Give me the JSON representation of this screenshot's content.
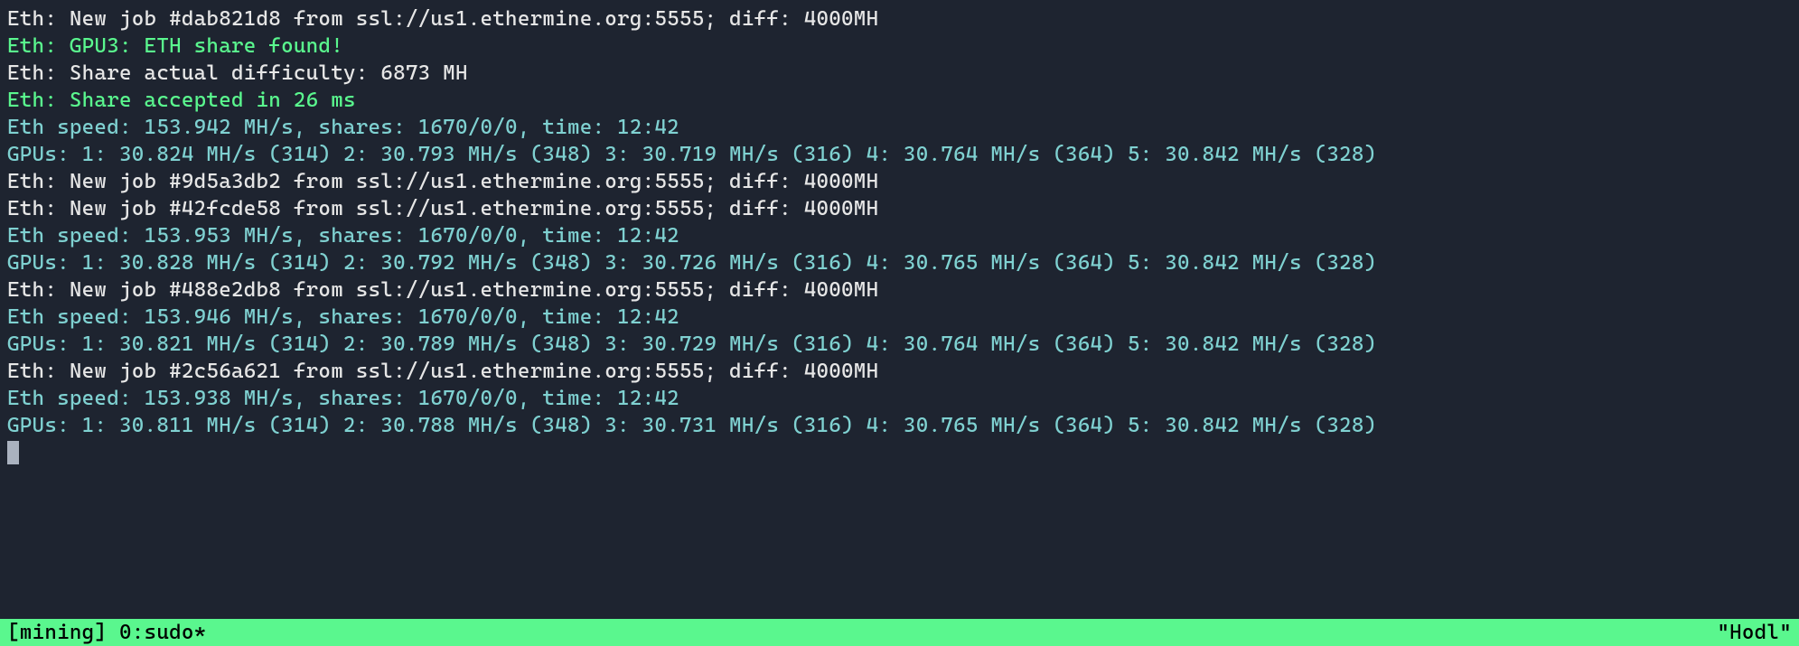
{
  "colors": {
    "bg": "#1e2430",
    "white": "#e6e6e6",
    "green": "#5af78e",
    "cyan": "#7fd1d1",
    "statusbar_bg": "#5af78e",
    "statusbar_fg": "#000000"
  },
  "lines": [
    {
      "color": "white",
      "text": "Eth: New job #dab821d8 from ssl://us1.ethermine.org:5555; diff: 4000MH"
    },
    {
      "color": "green",
      "text": "Eth: GPU3: ETH share found!"
    },
    {
      "color": "white",
      "text": "Eth: Share actual difficulty: 6873 MH"
    },
    {
      "color": "green",
      "text": "Eth: Share accepted in 26 ms"
    },
    {
      "color": "cyan",
      "text": "Eth speed: 153.942 MH/s, shares: 1670/0/0, time: 12:42"
    },
    {
      "color": "cyan",
      "text": "GPUs: 1: 30.824 MH/s (314) 2: 30.793 MH/s (348) 3: 30.719 MH/s (316) 4: 30.764 MH/s (364) 5: 30.842 MH/s (328)"
    },
    {
      "color": "white",
      "text": "Eth: New job #9d5a3db2 from ssl://us1.ethermine.org:5555; diff: 4000MH"
    },
    {
      "color": "white",
      "text": "Eth: New job #42fcde58 from ssl://us1.ethermine.org:5555; diff: 4000MH"
    },
    {
      "color": "cyan",
      "text": "Eth speed: 153.953 MH/s, shares: 1670/0/0, time: 12:42"
    },
    {
      "color": "cyan",
      "text": "GPUs: 1: 30.828 MH/s (314) 2: 30.792 MH/s (348) 3: 30.726 MH/s (316) 4: 30.765 MH/s (364) 5: 30.842 MH/s (328)"
    },
    {
      "color": "white",
      "text": "Eth: New job #488e2db8 from ssl://us1.ethermine.org:5555; diff: 4000MH"
    },
    {
      "color": "cyan",
      "text": "Eth speed: 153.946 MH/s, shares: 1670/0/0, time: 12:42"
    },
    {
      "color": "cyan",
      "text": "GPUs: 1: 30.821 MH/s (314) 2: 30.789 MH/s (348) 3: 30.729 MH/s (316) 4: 30.764 MH/s (364) 5: 30.842 MH/s (328)"
    },
    {
      "color": "white",
      "text": "Eth: New job #2c56a621 from ssl://us1.ethermine.org:5555; diff: 4000MH"
    },
    {
      "color": "cyan",
      "text": "Eth speed: 153.938 MH/s, shares: 1670/0/0, time: 12:42"
    },
    {
      "color": "cyan",
      "text": "GPUs: 1: 30.811 MH/s (314) 2: 30.788 MH/s (348) 3: 30.731 MH/s (316) 4: 30.765 MH/s (364) 5: 30.842 MH/s (328)"
    }
  ],
  "statusbar": {
    "left": "[mining] 0:sudo*",
    "right": "\"Hodl\""
  }
}
